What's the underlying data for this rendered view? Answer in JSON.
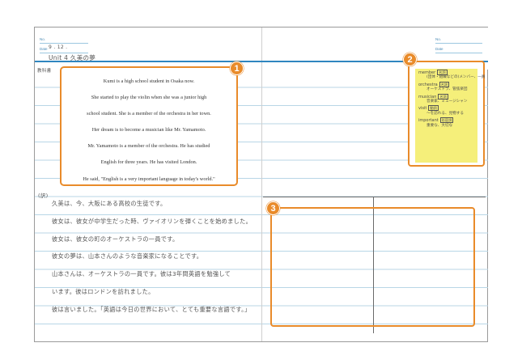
{
  "left_page": {
    "no_label": "No.",
    "date_label": "Date",
    "date_value": "9 . 12 .",
    "unit_title": "Unit 4   久美の夢",
    "section_label": "教科書",
    "english_text": [
      "Kumi is a high school student in Osaka now.",
      "She started to play the violin when she was a junior high",
      "school student. She is a member of the orchestra in her town.",
      "Her dream is to become a musician like Mr. Yamamoto.",
      "Mr. Yamamoto is a member of the orchestra. He has studied",
      "English for three years. He has visited London.",
      "He said, \"English is a very important language in today's world.\""
    ],
    "translation_label": "(訳)",
    "translation_lines": [
      "久美は、今、大阪にある高校の生徒です。",
      "彼女は、彼女が中学生だった時、ヴァイオリンを弾くことを始めました。",
      "彼女は、彼女の町のオーケストラの一員です。",
      "彼女の夢は、山本さんのような音楽家になることです。",
      "山本さんは、オーケストラの一員です。彼は3年間英語を勉強して",
      "います。彼はロンドンを訪れました。",
      "彼は言いました。「英語は今日の世界において、とても重要な言語です。」"
    ]
  },
  "right_page": {
    "no_label": "No.",
    "date_label": "Date"
  },
  "vocab": [
    {
      "word": "member",
      "tag": "名詞",
      "meaning": "(団体・組織などの)メンバー、一員"
    },
    {
      "word": "orchestra",
      "tag": "名詞",
      "meaning": "オーケストラ、管弦楽団"
    },
    {
      "word": "musician",
      "tag": "名詞",
      "meaning": "音楽家、ミュージシャン"
    },
    {
      "word": "visit",
      "tag": "動詞",
      "meaning": "〜を訪れる、見物する"
    },
    {
      "word": "important",
      "tag": "形容詞",
      "meaning": "重要な、大切な"
    }
  ],
  "badges": [
    "1",
    "2",
    "3"
  ],
  "colors": {
    "accent": "#e98b2a",
    "rule": "#b8d6e6",
    "sticky": "#f5ef7a"
  }
}
